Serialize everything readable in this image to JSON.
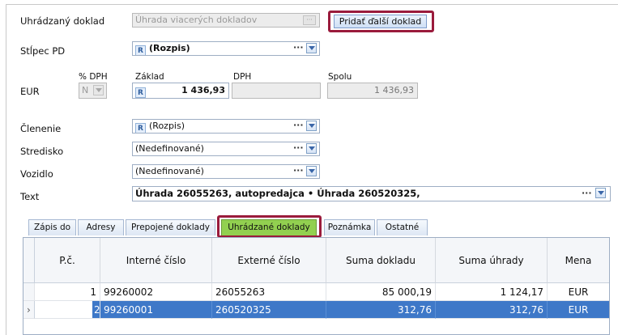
{
  "form": {
    "uhradzany_doklad": {
      "label": "Uhrádzaný doklad",
      "value": "Úhrada viacerých dokladov",
      "button": "Pridať ďalší doklad"
    },
    "stlpec_pd": {
      "label": "Stĺpec PD",
      "badge": "R",
      "value": "(Rozpis)"
    },
    "amounts": {
      "currency": "EUR",
      "dph_pct_label": "% DPH",
      "dph_pct_value": "N",
      "zaklad_label": "Základ",
      "zaklad_value": "1 436,93",
      "dph_label": "DPH",
      "dph_value": "",
      "spolu_label": "Spolu",
      "spolu_value": "1 436,93"
    },
    "clenenie": {
      "label": "Členenie",
      "badge": "R",
      "value": "(Rozpis)"
    },
    "stredisko": {
      "label": "Stredisko",
      "value": "(Nedefinované)"
    },
    "vozidlo": {
      "label": "Vozidlo",
      "value": "(Nedefinované)"
    },
    "text": {
      "label": "Text",
      "value": "Úhrada 26055263, autopredajca • Úhrada 260520325,"
    },
    "dots": "···"
  },
  "tabs": [
    "Zápis do",
    "Adresy",
    "Prepojené doklady",
    "Uhrádzané doklady",
    "Poznámka",
    "Ostatné"
  ],
  "active_tab": "Uhrádzané doklady",
  "table": {
    "columns": [
      "P.č.",
      "Interné číslo",
      "Externé číslo",
      "Suma dokladu",
      "Suma úhrady",
      "Mena"
    ],
    "rows": [
      {
        "pc": "1",
        "interne": "99260002",
        "externe": "26055263",
        "suma_dokladu": "85 000,19",
        "suma_uhrady": "1 124,17",
        "mena": "EUR"
      },
      {
        "pc": "2",
        "interne": "99260001",
        "externe": "260520325",
        "suma_dokladu": "312,76",
        "suma_uhrady": "312,76",
        "mena": "EUR"
      }
    ],
    "row_indicator": "›"
  },
  "colors": {
    "highlight": "#9a1b3c",
    "active_tab": "#92d050",
    "selected_row": "#3e78c8"
  }
}
